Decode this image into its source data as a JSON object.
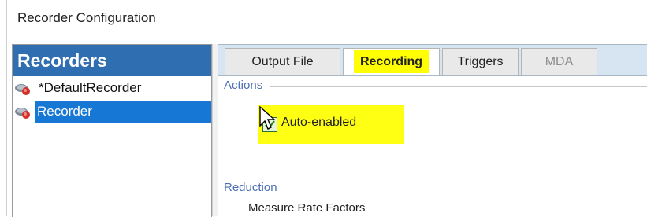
{
  "window": {
    "title": "Recorder Configuration"
  },
  "recorders": {
    "header": "Recorders",
    "items": [
      {
        "label": "*DefaultRecorder",
        "selected": false,
        "icon": "recorder-icon"
      },
      {
        "label": "Recorder",
        "selected": true,
        "icon": "recorder-icon"
      }
    ]
  },
  "tabs": [
    {
      "label": "Output File",
      "active": false
    },
    {
      "label": "Recording",
      "active": true,
      "highlight": "#ffff00"
    },
    {
      "label": "Triggers",
      "active": false
    },
    {
      "label": "MDA",
      "active": false,
      "disabled": true
    }
  ],
  "actions": {
    "group_label": "Actions",
    "auto_enabled": {
      "label": "Auto-enabled",
      "checked": true,
      "highlight": "#ffff14"
    }
  },
  "reduction": {
    "group_label": "Reduction",
    "item": "Measure Rate Factors"
  },
  "colors": {
    "accent": "#2f6fb1",
    "selection": "#1777d4",
    "tab_band": "#d7e5f3"
  }
}
